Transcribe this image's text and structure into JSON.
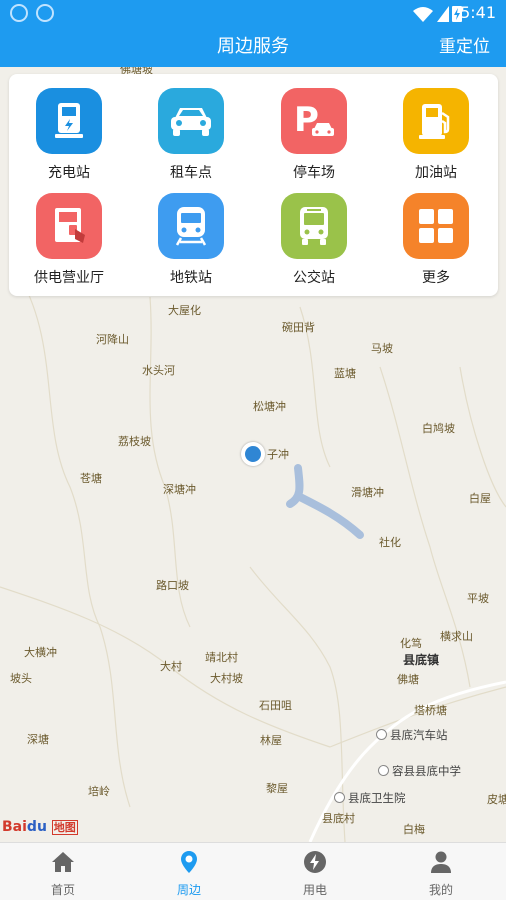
{
  "status_bar": {
    "time": "5:41"
  },
  "header": {
    "title": "周边服务",
    "relocate_label": "重定位"
  },
  "services": [
    {
      "label": "充电站",
      "icon": "charging-station-icon",
      "color": "#1a8fe0"
    },
    {
      "label": "租车点",
      "icon": "car-rental-icon",
      "color": "#2aa9dd"
    },
    {
      "label": "停车场",
      "icon": "parking-icon",
      "color": "#f26464"
    },
    {
      "label": "加油站",
      "icon": "gas-station-icon",
      "color": "#f5b400"
    },
    {
      "label": "供电营业厅",
      "icon": "power-office-icon",
      "color": "#f26464"
    },
    {
      "label": "地铁站",
      "icon": "subway-icon",
      "color": "#3e9cf0"
    },
    {
      "label": "公交站",
      "icon": "bus-icon",
      "color": "#9ac24a"
    },
    {
      "label": "更多",
      "icon": "more-grid-icon",
      "color": "#f5832a"
    }
  ],
  "map": {
    "places": [
      "佛塘坡",
      "大屋化",
      "碗田背",
      "河降山",
      "马坡",
      "水头河",
      "蓝塘",
      "松塘冲",
      "白鸠坡",
      "荔枝坡",
      "子冲",
      "苍塘",
      "深塘冲",
      "滑塘冲",
      "白屋",
      "社化",
      "路口坡",
      "平坡",
      "大横冲",
      "化笃",
      "横求山",
      "县底镇",
      "坡头",
      "大村",
      "靖北村",
      "大村坡",
      "佛塘",
      "塔桥塘",
      "石田咀",
      "深塘",
      "林屋",
      "县底汽车站",
      "容县县底中学",
      "培岭",
      "黎屋",
      "县底卫生院",
      "皮塘",
      "县底村",
      "白梅"
    ],
    "logo_text": "Bai",
    "logo_map_word": "地图"
  },
  "nav": [
    {
      "label": "首页",
      "icon": "home-icon",
      "active": false
    },
    {
      "label": "周边",
      "icon": "location-pin-icon",
      "active": true
    },
    {
      "label": "用电",
      "icon": "lightning-icon",
      "active": false
    },
    {
      "label": "我的",
      "icon": "user-icon",
      "active": false
    }
  ],
  "colors": {
    "primary": "#1e9bf0",
    "map_bg": "#f1efe9",
    "river": "#a9bfdc"
  }
}
